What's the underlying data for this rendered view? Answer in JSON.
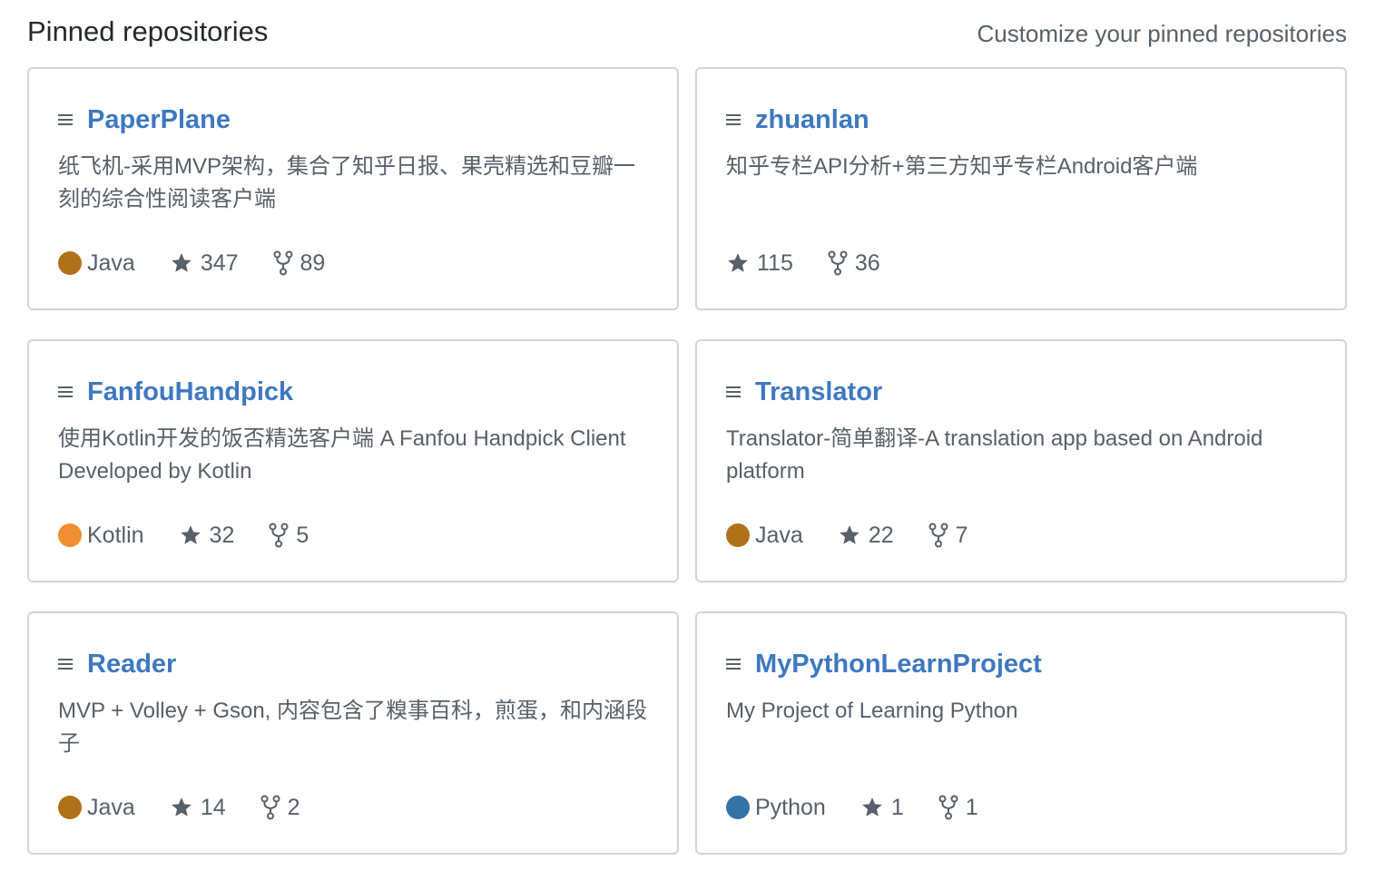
{
  "header": {
    "title": "Pinned repositories",
    "customize_label": "Customize your pinned repositories"
  },
  "repos": [
    {
      "name": "PaperPlane",
      "description": "纸飞机-采用MVP架构，集合了知乎日报、果壳精选和豆瓣一刻的综合性阅读客户端",
      "language": "Java",
      "language_color": "#b07219",
      "stars": "347",
      "forks": "89"
    },
    {
      "name": "zhuanlan",
      "description": "知乎专栏API分析+第三方知乎专栏Android客户端",
      "language": "",
      "language_color": "",
      "stars": "115",
      "forks": "36"
    },
    {
      "name": "FanfouHandpick",
      "description": "使用Kotlin开发的饭否精选客户端 A Fanfou Handpick Client Developed by Kotlin",
      "language": "Kotlin",
      "language_color": "#F18E33",
      "stars": "32",
      "forks": "5"
    },
    {
      "name": "Translator",
      "description": "Translator-简单翻译-A translation app based on Android platform",
      "language": "Java",
      "language_color": "#b07219",
      "stars": "22",
      "forks": "7"
    },
    {
      "name": "Reader",
      "description": "MVP + Volley + Gson, 内容包含了糗事百科，煎蛋，和内涵段子",
      "language": "Java",
      "language_color": "#b07219",
      "stars": "14",
      "forks": "2"
    },
    {
      "name": "MyPythonLearnProject",
      "description": "My Project of Learning Python",
      "language": "Python",
      "language_color": "#3572A5",
      "stars": "1",
      "forks": "1"
    }
  ],
  "colors": {
    "link": "#3e78c0",
    "muted_text": "#586069",
    "border": "#d1d5da"
  }
}
